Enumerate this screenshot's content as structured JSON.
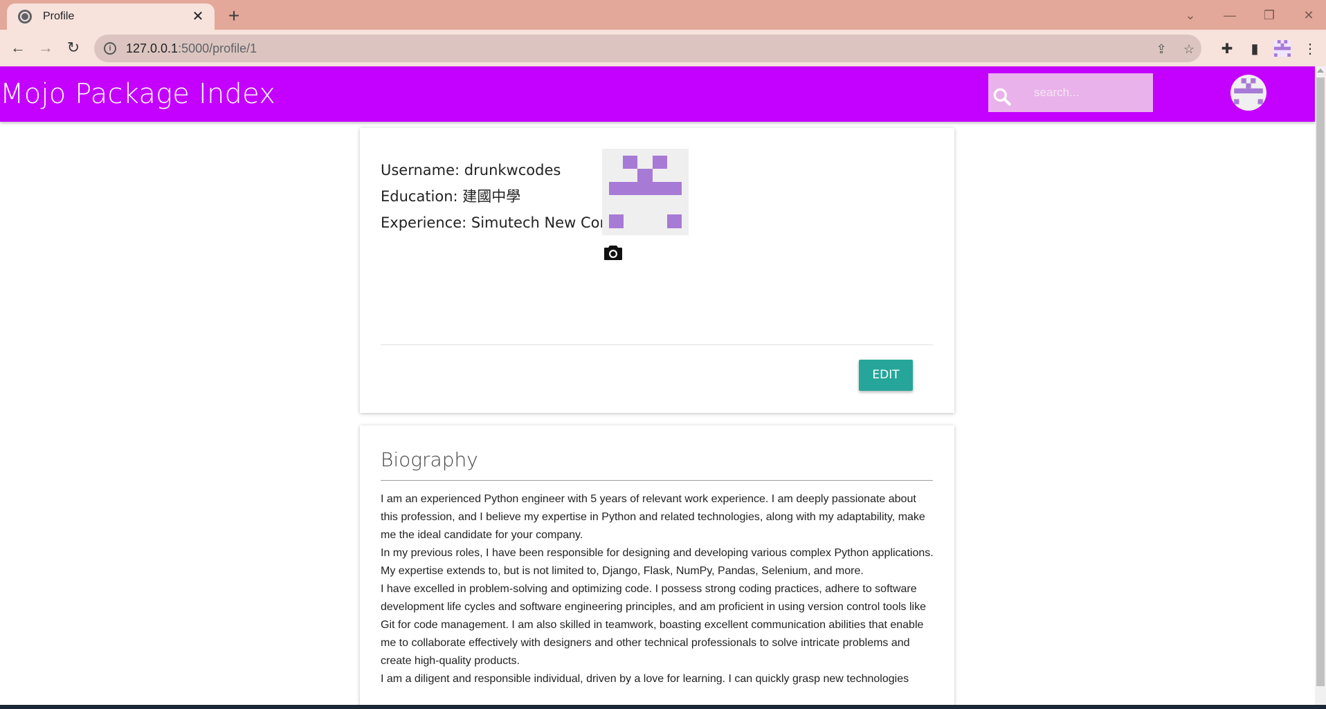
{
  "browser": {
    "tab_title": "Profile",
    "url_host": "127.0.0.1",
    "url_path": ":5000/profile/1"
  },
  "app": {
    "brand": "Mojo Package Index",
    "search_placeholder": "search...",
    "accent_color": "#c400ff"
  },
  "profile": {
    "username_line": "Username: drunkwcodes",
    "education_line": "Education: 建國中學",
    "experience_line": "Experience: Simutech New Comer",
    "edit_label": "EDIT",
    "avatar_color": "#a77ad6"
  },
  "biography": {
    "title": "Biography",
    "paragraphs": [
      "I am an experienced Python engineer with 5 years of relevant work experience. I am deeply passionate about this profession, and I believe my expertise in Python and related technologies, along with my adaptability, make me the ideal candidate for your company.",
      "In my previous roles, I have been responsible for designing and developing various complex Python applications. My expertise extends to, but is not limited to, Django, Flask, NumPy, Pandas, Selenium, and more.",
      "I have excelled in problem-solving and optimizing code. I possess strong coding practices, adhere to software development life cycles and software engineering principles, and am proficient in using version control tools like Git for code management. I am also skilled in teamwork, boasting excellent communication abilities that enable me to collaborate effectively with designers and other technical professionals to solve intricate problems and create high-quality products.",
      "I am a diligent and responsible individual, driven by a love for learning. I can quickly grasp new technologies"
    ]
  }
}
